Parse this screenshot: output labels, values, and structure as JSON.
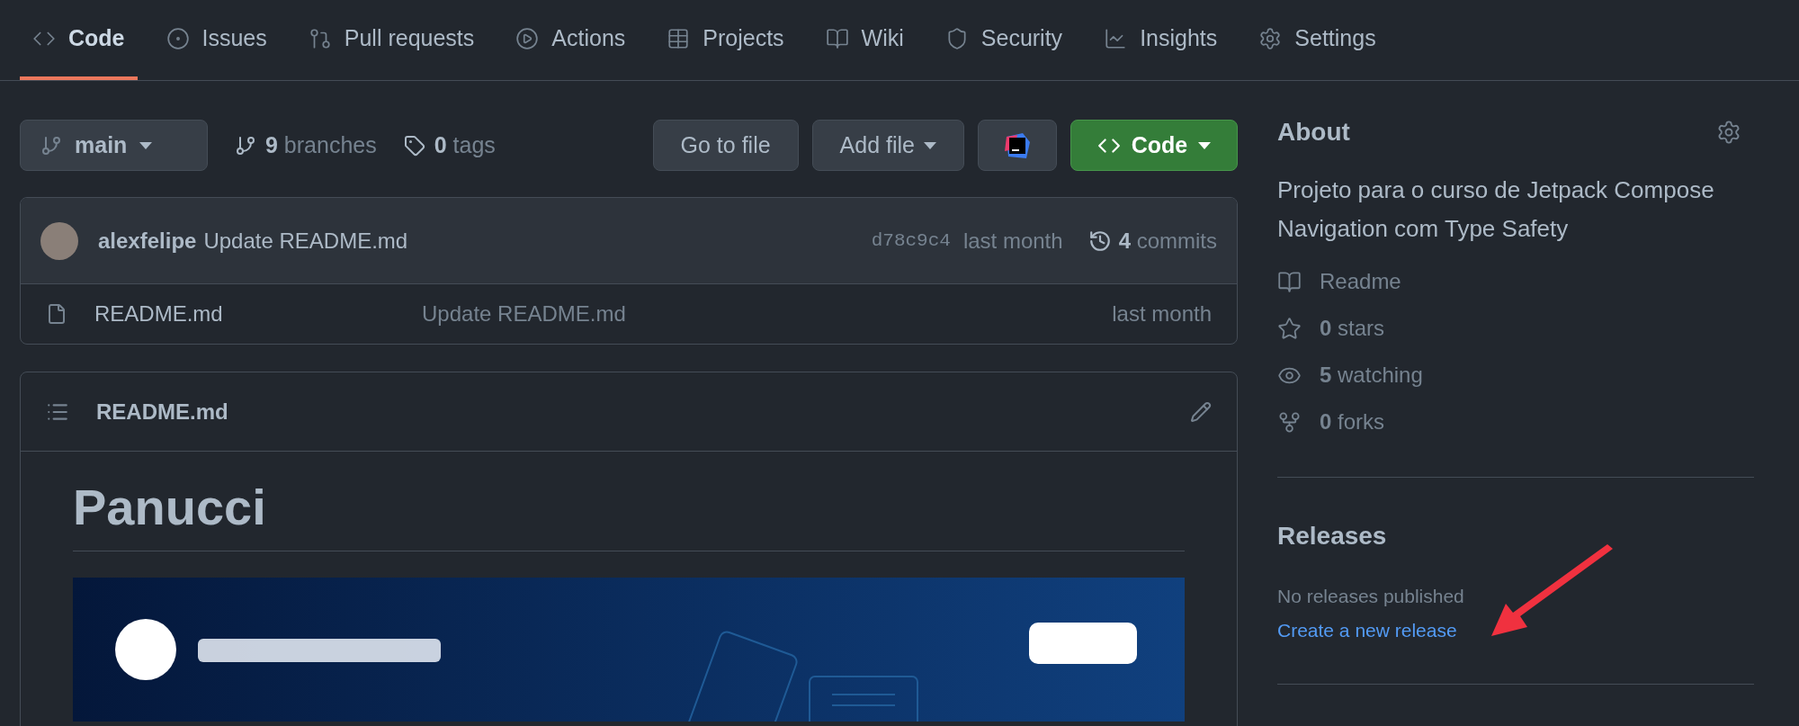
{
  "tabs": [
    {
      "label": "Code",
      "selected": true
    },
    {
      "label": "Issues",
      "selected": false
    },
    {
      "label": "Pull requests",
      "selected": false
    },
    {
      "label": "Actions",
      "selected": false
    },
    {
      "label": "Projects",
      "selected": false
    },
    {
      "label": "Wiki",
      "selected": false
    },
    {
      "label": "Security",
      "selected": false
    },
    {
      "label": "Insights",
      "selected": false
    },
    {
      "label": "Settings",
      "selected": false
    }
  ],
  "toolbar": {
    "branch": "main",
    "branches": {
      "count": "9",
      "label": "branches"
    },
    "tags": {
      "count": "0",
      "label": "tags"
    },
    "buttons": [
      "Go to file",
      "Add file"
    ],
    "code_button": "Code"
  },
  "latest_commit": {
    "author": "alexfelipe",
    "message": "Update README.md",
    "sha": "d78c9c4",
    "time": "last month",
    "commits": {
      "count": "4",
      "label": "commits"
    }
  },
  "files": [
    {
      "name": "README.md",
      "message": "Update README.md",
      "time": "last month"
    }
  ],
  "readme": {
    "filename": "README.md",
    "heading": "Panucci"
  },
  "about": {
    "title": "About",
    "description": "Projeto para o curso de Jetpack Compose Navigation com Type Safety",
    "items": [
      {
        "label": "Readme"
      },
      {
        "count": "0",
        "label": "stars"
      },
      {
        "count": "5",
        "label": "watching"
      },
      {
        "count": "0",
        "label": "forks"
      }
    ]
  },
  "releases": {
    "title": "Releases",
    "empty_text": "No releases published",
    "link": "Create a new release"
  }
}
